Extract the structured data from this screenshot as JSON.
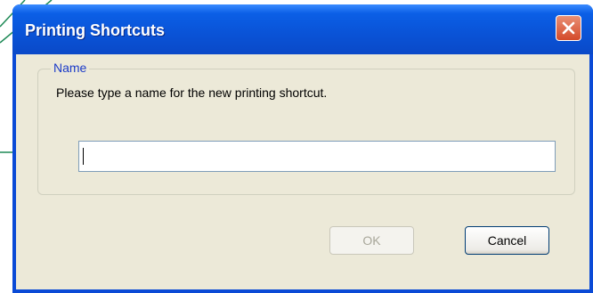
{
  "window": {
    "title": "Printing Shortcuts",
    "close_icon": "close-icon"
  },
  "name_group": {
    "legend": "Name",
    "description": "Please type a name for the new printing shortcut.",
    "input_value": ""
  },
  "buttons": {
    "ok_label": "OK",
    "ok_enabled": false,
    "cancel_label": "Cancel"
  },
  "colors": {
    "title_bar": "#0a54d8",
    "close_button": "#d44a2a",
    "dialog_face": "#ece9d8",
    "group_label": "#1a3ac8",
    "callout_line": "#1f8a57"
  }
}
